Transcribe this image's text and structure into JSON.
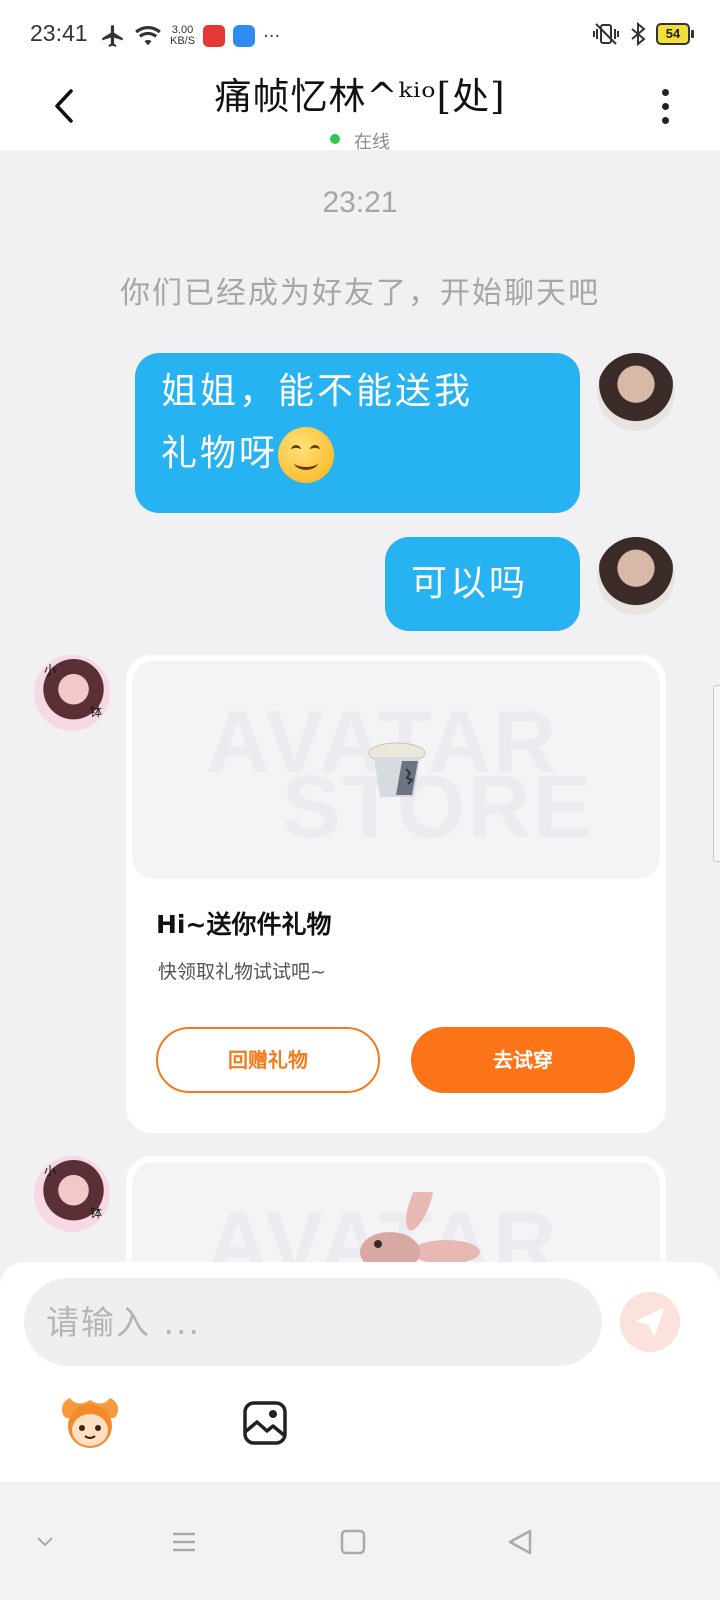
{
  "status_bar": {
    "time": "23:41",
    "net_speed_value": "3.00",
    "net_speed_unit": "KB/S",
    "more": "···",
    "battery": "54",
    "icons": [
      "airplane-icon",
      "wifi-icon",
      "app-icon",
      "app-icon",
      "vibrate-icon",
      "bluetooth-icon",
      "battery-icon"
    ]
  },
  "header": {
    "title": "痛帧忆林^ᵏⁱᵒ[处]",
    "status": "在线"
  },
  "chat": {
    "timestamp": "23:21",
    "system_message": "你们已经成为好友了，开始聊天吧",
    "messages": [
      {
        "text_line1": "姐姐，能不能送我",
        "text_line2": "礼物呀",
        "emoji": "smiling-face"
      },
      {
        "text": "可以吗"
      }
    ],
    "gift_card": {
      "watermark_line1": "AVATAR",
      "watermark_line2": "STORE",
      "title": "Hi~送你件礼物",
      "subtitle": "快领取礼物试试吧~",
      "return_gift_label": "回赠礼物",
      "try_on_label": "去试穿"
    },
    "avatar_tag_top": "小",
    "avatar_tag_bottom": "钵"
  },
  "composer": {
    "placeholder": "请输入 ..."
  },
  "colors": {
    "bubble": "#27b3f2",
    "accent_orange": "#fb7417",
    "online_dot": "#2ec552"
  }
}
